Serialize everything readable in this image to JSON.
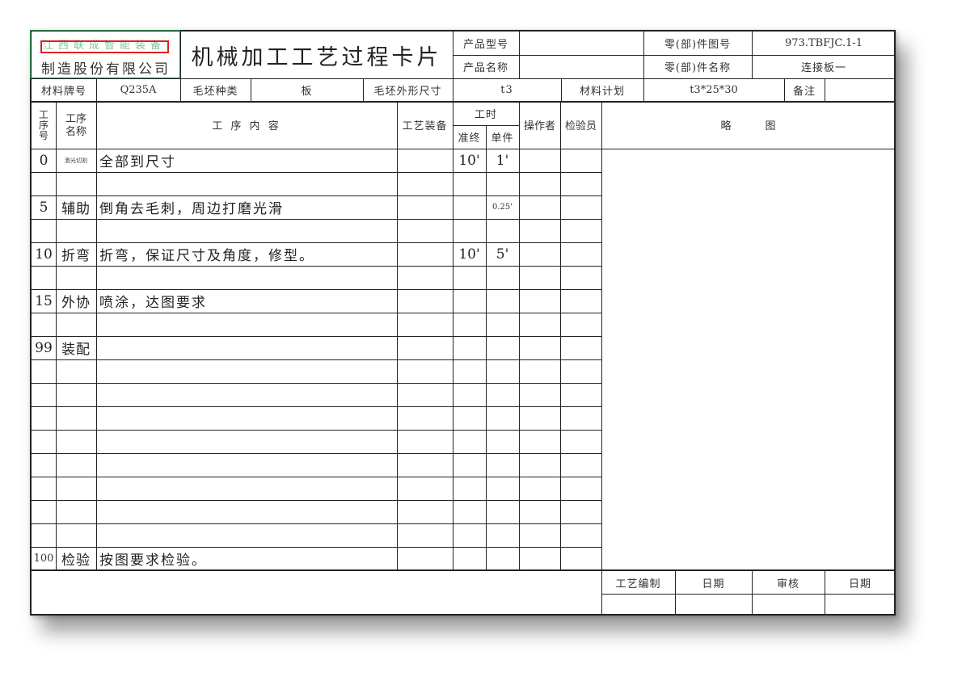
{
  "header": {
    "company_logo_text": "江西联成智能装备",
    "company_name": "制造股份有限公司",
    "title": "机械加工工艺过程卡片",
    "product_model_label": "产品型号",
    "product_model_value": "",
    "product_name_label": "产品名称",
    "product_name_value": "",
    "part_no_label": "零(部)件图号",
    "part_no_value": "973.TBFJC.1-1",
    "part_name_label": "零(部)件名称",
    "part_name_value": "连接板一"
  },
  "material_row": {
    "material_grade_label": "材料牌号",
    "material_grade_value": "Q235A",
    "blank_type_label": "毛坯种类",
    "blank_type_value": "板",
    "blank_size_label": "毛坯外形尺寸",
    "blank_size_value": "t3",
    "material_plan_label": "材料计划",
    "material_plan_value": "t3*25*30",
    "remark_label": "备注",
    "remark_value": ""
  },
  "table_header": {
    "step_no": [
      "工",
      "序",
      "号"
    ],
    "step_name": [
      "工序",
      "名称"
    ],
    "content": "工  序  内  容",
    "equipment": "工艺装备",
    "work_time": "工时",
    "prep_time": "准终",
    "unit_time": "单件",
    "operator": "操作者",
    "inspector": "检验员",
    "sketch": "略        图"
  },
  "steps": [
    {
      "no": "0",
      "name": "激光切割",
      "content": "全部到尺寸",
      "prep": "10'",
      "unit": "1'"
    },
    {
      "no": "5",
      "name": "辅助",
      "content": "倒角去毛刺，周边打磨光滑",
      "prep": "",
      "unit": "0.25'"
    },
    {
      "no": "10",
      "name": "折弯",
      "content": "折弯，保证尺寸及角度，修型。",
      "prep": "10'",
      "unit": "5'"
    },
    {
      "no": "15",
      "name": "外协",
      "content": "喷涂，达图要求",
      "prep": "",
      "unit": ""
    },
    {
      "no": "99",
      "name": "装配",
      "content": "",
      "prep": "",
      "unit": ""
    },
    {
      "no": "100",
      "name": "检验",
      "content": "按图要求检验。",
      "prep": "",
      "unit": ""
    }
  ],
  "footer": {
    "prepared_label": "工艺编制",
    "date1_label": "日期",
    "review_label": "审核",
    "date2_label": "日期"
  }
}
